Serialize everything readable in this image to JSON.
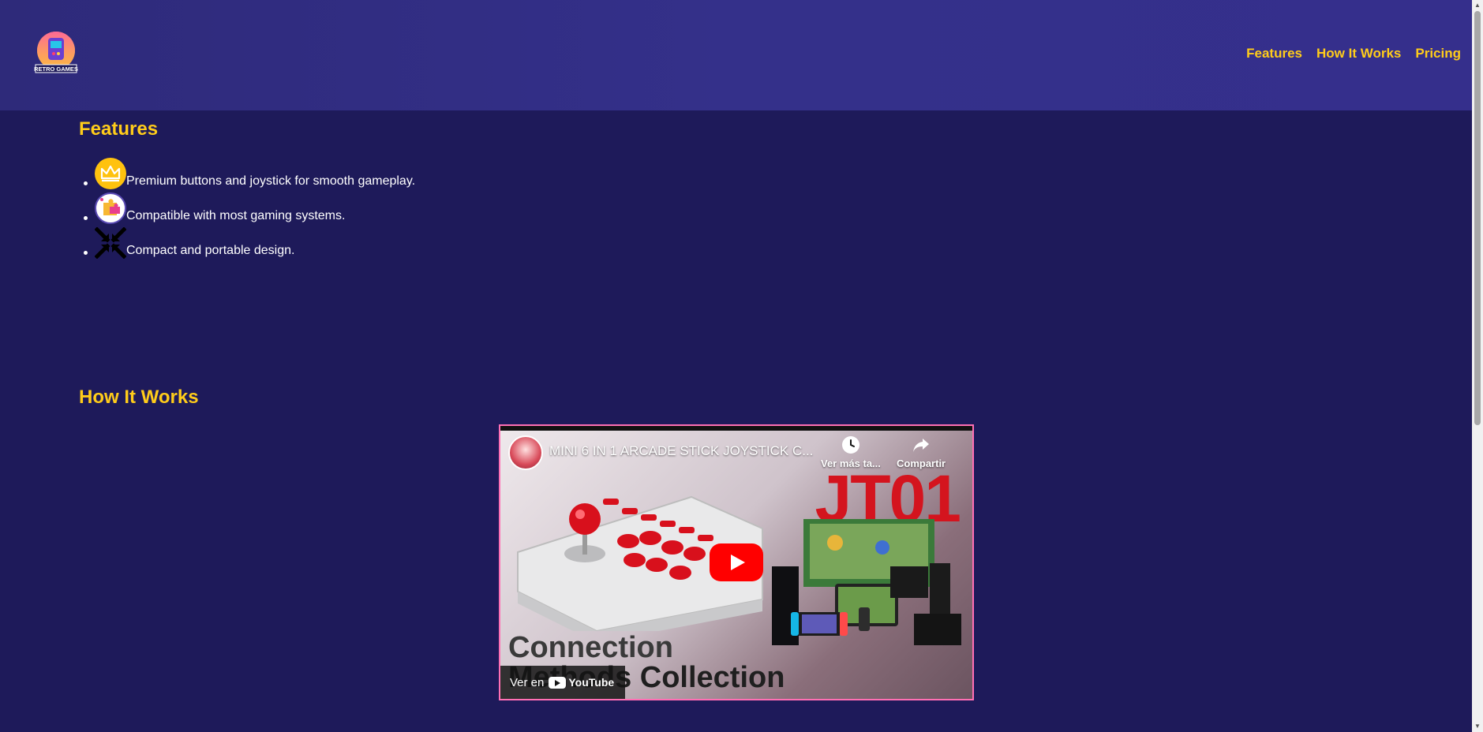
{
  "header": {
    "logo_text": "RETRO GAMES",
    "nav": [
      {
        "label": "Features"
      },
      {
        "label": "How It Works"
      },
      {
        "label": "Pricing"
      }
    ]
  },
  "features": {
    "title": "Features",
    "items": [
      {
        "icon": "crown-icon",
        "text": "Premium buttons and joystick for smooth gameplay."
      },
      {
        "icon": "puzzle-icon",
        "text": "Compatible with most gaming systems."
      },
      {
        "icon": "compress-icon",
        "text": "Compact and portable design."
      }
    ]
  },
  "how_it_works": {
    "title": "How It Works",
    "video": {
      "title": "MINI 6 IN 1 ARCADE STICK JOYSTICK C...",
      "watch_later": "Ver más ta...",
      "share": "Compartir",
      "brand_big": "JT01",
      "caption_line1": "Connection",
      "caption_line2": "Methods Collection",
      "watch_on": "Ver en",
      "youtube": "YouTube"
    }
  },
  "colors": {
    "accent": "#ffcc1a",
    "page_bg": "#1e1a5a",
    "header_bg": "#322e85",
    "video_border": "#ff6fb4"
  }
}
